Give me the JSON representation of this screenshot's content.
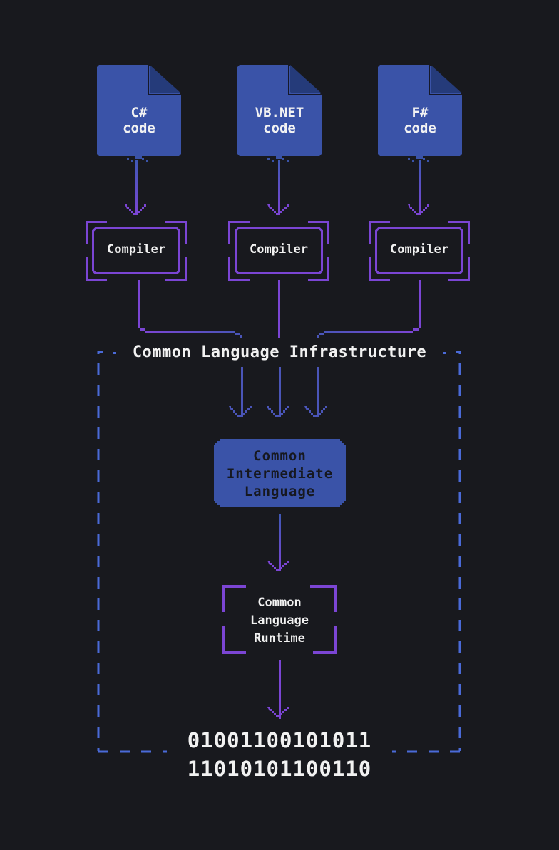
{
  "sources": [
    {
      "label": "C#\ncode"
    },
    {
      "label": "VB.NET\ncode"
    },
    {
      "label": "F#\ncode"
    }
  ],
  "compilers": [
    {
      "label": "Compiler"
    },
    {
      "label": "Compiler"
    },
    {
      "label": "Compiler"
    }
  ],
  "cli": {
    "title": "Common Language Infrastructure"
  },
  "cil": {
    "label": "Common\nIntermediate\nLanguage"
  },
  "clr": {
    "label": "Common\nLanguage\nRuntime"
  },
  "output": {
    "lines": [
      "01001100101011",
      "11010101100110"
    ]
  },
  "colors": {
    "background": "#18191e",
    "doc_blue": "#3a53a8",
    "doc_fold": "#253b7a",
    "purple": "#7b45d4",
    "dashed_blue": "#4a6ad8",
    "text": "#f2f2f2"
  }
}
